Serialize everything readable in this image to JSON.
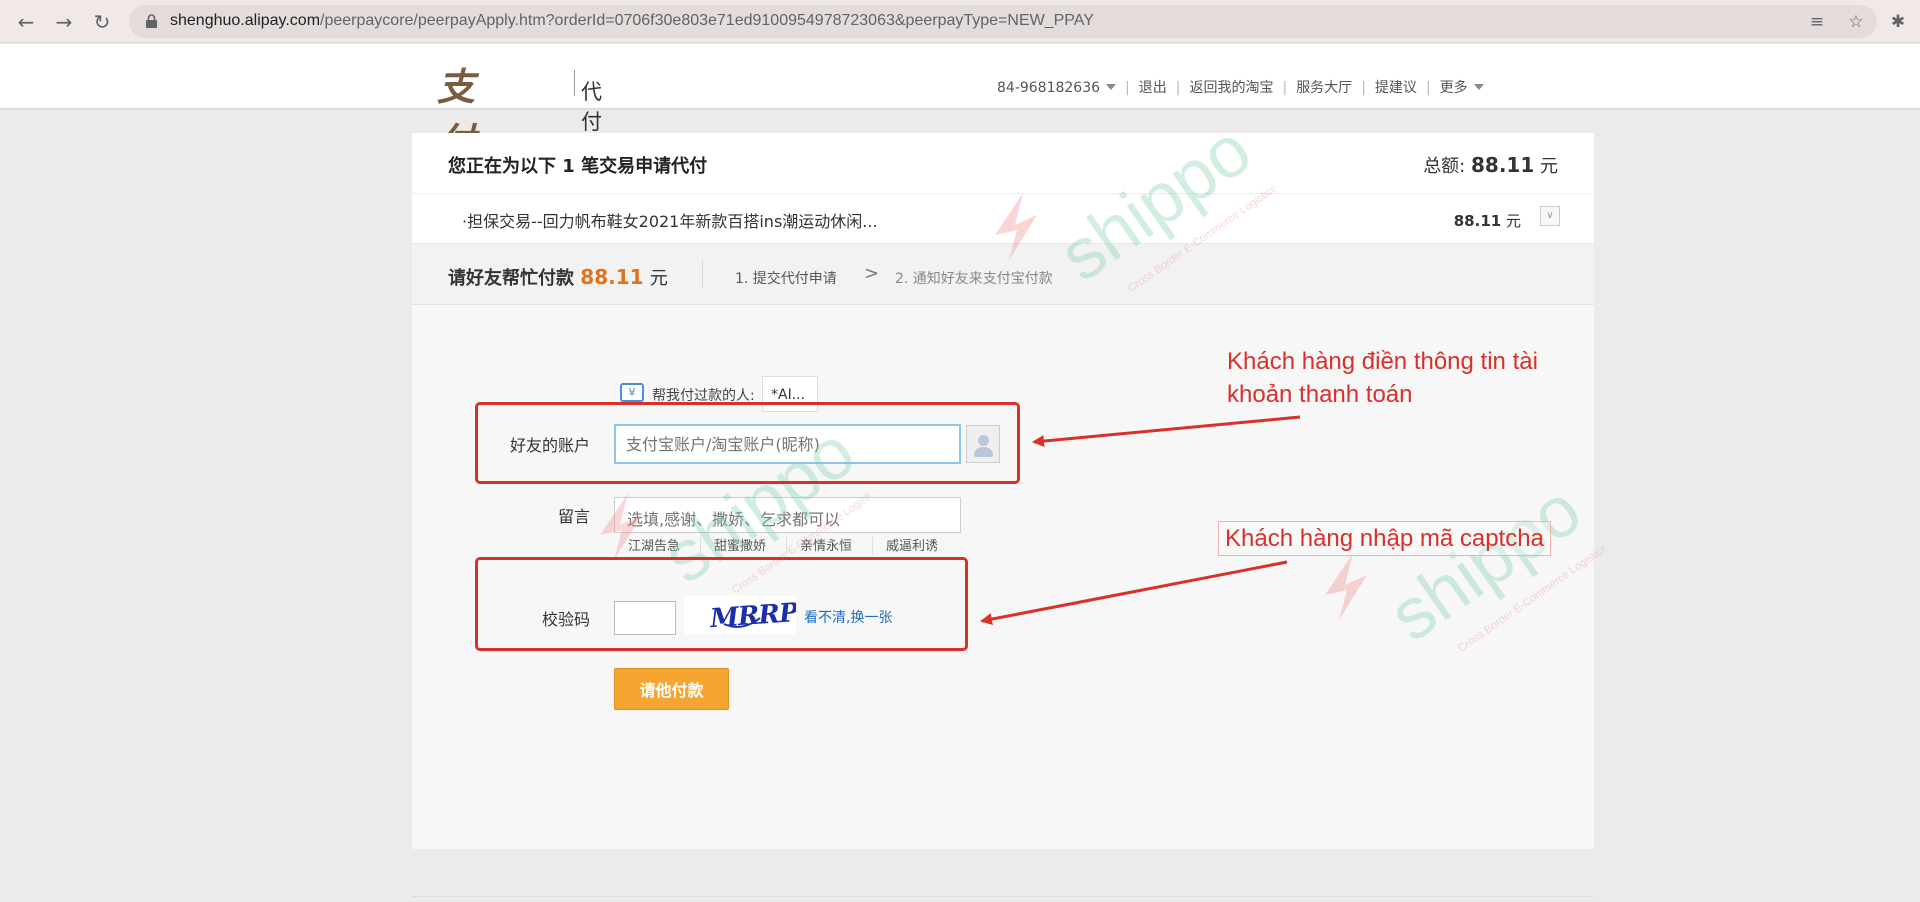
{
  "browser": {
    "url_host": "shenghuo.alipay.com",
    "url_path": "/peerpaycore/peerpayApply.htm?orderId=0706f30e803e71ed9100954978723063&peerpayType=NEW_PPAY",
    "icons": [
      "back-icon",
      "forward-icon",
      "reload-icon",
      "lock-icon",
      "translate-icon",
      "star-icon",
      "extensions-icon"
    ]
  },
  "header": {
    "logo_text": "支付宝",
    "logo_sub": "代付",
    "nav": {
      "account": "84-968182636",
      "logout": "退出",
      "back_to_taobao": "返回我的淘宝",
      "service_hall": "服务大厅",
      "suggest": "提建议",
      "more": "更多"
    }
  },
  "order": {
    "title_prefix": "您正在为以下",
    "title_count": "1",
    "title_suffix": "笔交易申请代付",
    "total_label": "总额:",
    "total_amount": "88.11",
    "currency": "元",
    "item_text": "·担保交易--回力帆布鞋女2021年新款百搭ins潮运动休闲...",
    "item_amount": "88.11",
    "item_currency": "元"
  },
  "steps": {
    "request_label": "请好友帮忙付款",
    "request_amount": "88.11",
    "request_currency": "元",
    "step1": "1. 提交代付申请",
    "arrow": ">",
    "step2": "2. 通知好友来支付宝付款"
  },
  "form": {
    "payer_label": "帮我付过款的人:",
    "payer_value": "*AI...",
    "account_label": "好友的账户",
    "account_placeholder": "支付宝账户/淘宝账户(昵称)",
    "message_label": "留言",
    "message_placeholder": "选填,感谢、撒娇、乞求都可以",
    "message_chips": [
      "江湖告急",
      "甜蜜撒娇",
      "亲情永恒",
      "威逼利诱"
    ],
    "captcha_label": "校验码",
    "captcha_text": "MRRP",
    "captcha_refresh": "看不清,换一张",
    "submit_label": "请他付款"
  },
  "annotations": {
    "note1": "Khách hàng điền thông tin tài khoản thanh toán",
    "note2": "Khách hàng nhập mã captcha",
    "color": "#d9302a"
  },
  "watermark": {
    "brand": "shippo",
    "tagline": "Cross Border E-Commerce Logistics"
  }
}
